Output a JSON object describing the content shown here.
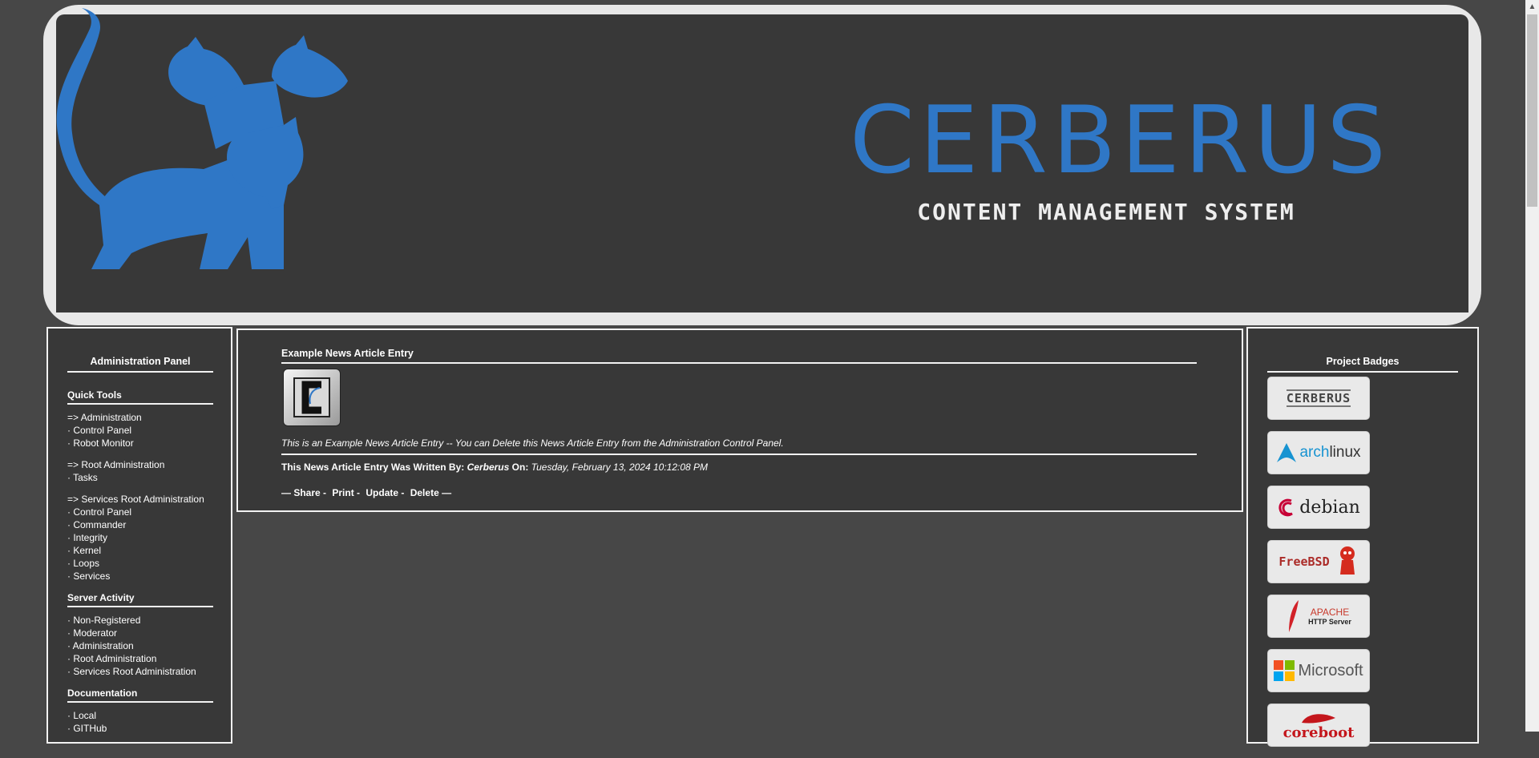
{
  "header": {
    "title": "CERBERUS",
    "subtitle": "CONTENT MANAGEMENT SYSTEM"
  },
  "admin_panel": {
    "title": "Administration Panel",
    "sections": [
      {
        "title": "Quick Tools",
        "groups": [
          [
            "=> Administration",
            "· Control Panel",
            "· Robot Monitor"
          ],
          [
            "=> Root Administration",
            "· Tasks"
          ],
          [
            "=> Services Root Administration",
            "· Control Panel",
            "· Commander",
            "· Integrity",
            "· Kernel",
            "· Loops",
            "· Services"
          ]
        ]
      },
      {
        "title": "Server Activity",
        "groups": [
          [
            "· Non-Registered",
            "· Moderator",
            "· Administration",
            "· Root Administration",
            "· Services Root Administration"
          ]
        ]
      },
      {
        "title": "Documentation",
        "groups": [
          [
            "· Local",
            "· GITHub"
          ]
        ]
      }
    ]
  },
  "article": {
    "title": "Example News Article Entry",
    "body": "This is an Example News Article Entry -- You can Delete this News Article Entry from the Administration Control Panel.",
    "byline_prefix": "This News Article Entry Was Written By:",
    "author": "Cerberus",
    "on_label": "On:",
    "date": "Tuesday, February 13, 2024 10:12:08 PM",
    "actions": [
      "— Share -",
      "Print -",
      "Update -",
      "Delete —"
    ]
  },
  "badges_panel": {
    "title": "Project Badges",
    "badges": [
      {
        "name": "cerberus",
        "label": "CERBERUS"
      },
      {
        "name": "archlinux",
        "label_a": "arch",
        "label_b": "linux"
      },
      {
        "name": "debian",
        "label": "debian"
      },
      {
        "name": "freebsd",
        "label": "FreeBSD"
      },
      {
        "name": "apache",
        "label_a": "APACHE",
        "label_b": "HTTP Server"
      },
      {
        "name": "microsoft",
        "label": "Microsoft"
      },
      {
        "name": "coreboot",
        "label": "coreboot"
      }
    ]
  },
  "colors": {
    "brand_blue": "#2f77c6",
    "background": "#474747",
    "panel": "#383838"
  }
}
